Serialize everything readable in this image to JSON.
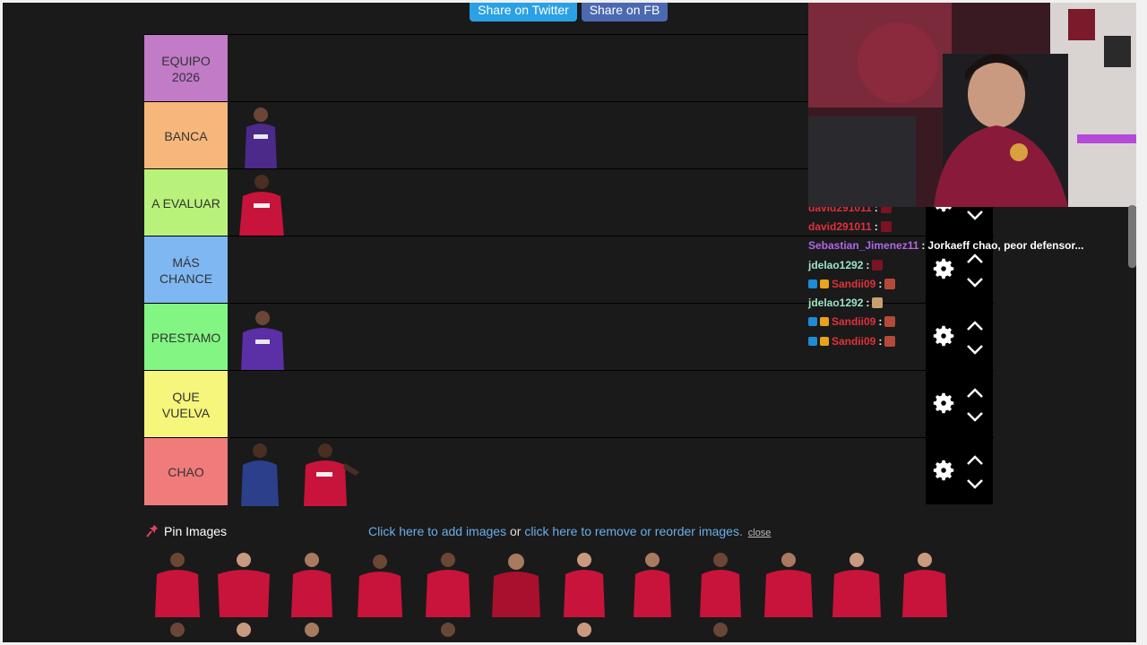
{
  "share": {
    "twitter": "Share on Twitter",
    "facebook": "Share on FB"
  },
  "tiers": [
    {
      "label": "EQUIPO\n2026",
      "color": "#c17bc7"
    },
    {
      "label": "BANCA",
      "color": "#f7b77a"
    },
    {
      "label": "A EVALUAR",
      "color": "#b9f27a"
    },
    {
      "label": "MÁS\nCHANCE",
      "color": "#7fb7f3"
    },
    {
      "label": "PRESTAMO",
      "color": "#83f583"
    },
    {
      "label": "QUE\nVUELVA",
      "color": "#f6f57c"
    },
    {
      "label": "CHAO",
      "color": "#f07b7b"
    }
  ],
  "chat": [
    {
      "user": "david291011",
      "text": "",
      "user_color": "#e0313b"
    },
    {
      "user": "david291011",
      "text": "",
      "user_color": "#e0313b"
    },
    {
      "user": "Sebastian_Jimenez11",
      "text": "Jorkaeff chao, peor defensor...",
      "user_color": "#b168e8"
    },
    {
      "user": "jdelao1292",
      "text": "",
      "user_color": "#9be3c8"
    },
    {
      "user": "Sandii09",
      "text": "",
      "user_color": "#e0313b"
    },
    {
      "user": "jdelao1292",
      "text": "",
      "user_color": "#9be3c8"
    },
    {
      "user": "Sandii09",
      "text": "",
      "user_color": "#e0313b"
    },
    {
      "user": "Sandii09",
      "text": "",
      "user_color": "#e0313b"
    }
  ],
  "pin": {
    "label": "Pin Images",
    "add_link": "Click here to add images",
    "or_text": " or ",
    "remove_link": "click here to remove or reorder images.",
    "close": "close"
  }
}
